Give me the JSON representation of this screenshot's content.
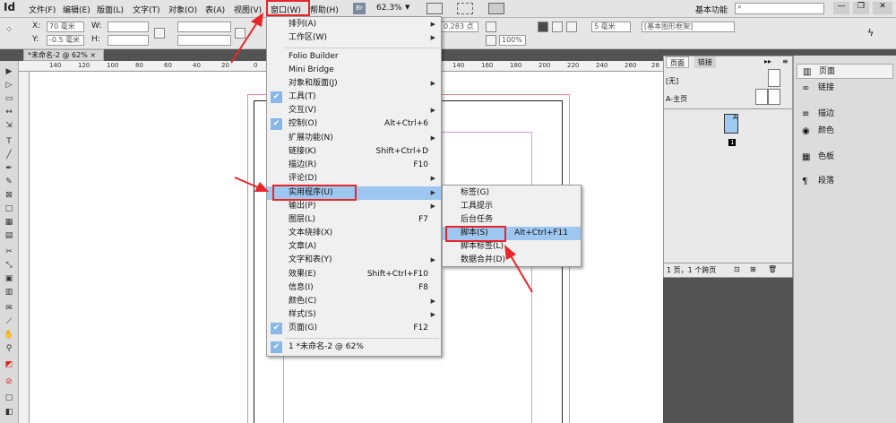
{
  "menubar": {
    "logo": "Id",
    "items": [
      "文件(F)",
      "编辑(E)",
      "版面(L)",
      "文字(T)",
      "对象(O)",
      "表(A)",
      "视图(V)",
      "窗口(W)",
      "帮助(H)"
    ],
    "br_label": "Br",
    "zoom": "62.3%",
    "workspace": "基本功能",
    "search_icon": "search-icon"
  },
  "control": {
    "x_label": "X:",
    "x_value": "70 毫米",
    "y_label": "Y:",
    "y_value": "-0.5 毫米",
    "w_label": "W:",
    "h_label": "H:",
    "stroke_value": "0.283 点",
    "scale_value": "100%",
    "mm_value": "5 毫米",
    "style_value": "[基本图形框架]"
  },
  "doc_tab": "*未命名-2 @ 62% ×",
  "ruler": [
    "140",
    "120",
    "100",
    "80",
    "60",
    "40",
    "20",
    "0",
    "20",
    "40",
    "60",
    "80",
    "100",
    "120",
    "140",
    "160",
    "180",
    "200",
    "220",
    "240",
    "260",
    "28"
  ],
  "window_menu": [
    {
      "label": "排列(A)",
      "submenu": true
    },
    {
      "label": "工作区(W)",
      "submenu": true
    },
    {
      "label": "Folio Builder"
    },
    {
      "label": "Mini Bridge"
    },
    {
      "label": "对象和版面(J)",
      "submenu": true
    },
    {
      "label": "工具(T)",
      "checked": true
    },
    {
      "label": "交互(V)",
      "submenu": true
    },
    {
      "label": "控制(O)",
      "checked": true,
      "shortcut": "Alt+Ctrl+6"
    },
    {
      "label": "扩展功能(N)",
      "submenu": true
    },
    {
      "label": "链接(K)",
      "shortcut": "Shift+Ctrl+D"
    },
    {
      "label": "描边(R)",
      "shortcut": "F10"
    },
    {
      "label": "评论(D)",
      "submenu": true
    },
    {
      "label": "实用程序(U)",
      "submenu": true,
      "highlighted": true
    },
    {
      "label": "输出(P)",
      "submenu": true
    },
    {
      "label": "图层(L)",
      "shortcut": "F7"
    },
    {
      "label": "文本绕排(X)"
    },
    {
      "label": "文章(A)"
    },
    {
      "label": "文字和表(Y)",
      "submenu": true
    },
    {
      "label": "效果(E)",
      "shortcut": "Shift+Ctrl+F10"
    },
    {
      "label": "信息(I)",
      "shortcut": "F8"
    },
    {
      "label": "颜色(C)",
      "submenu": true
    },
    {
      "label": "样式(S)",
      "submenu": true
    },
    {
      "label": "页面(G)",
      "checked": true,
      "shortcut": "F12"
    },
    {
      "label": "1 *未命名-2 @ 62%",
      "checked": true
    }
  ],
  "utility_submenu": [
    {
      "label": "标签(G)"
    },
    {
      "label": "工具提示"
    },
    {
      "label": "后台任务"
    },
    {
      "label": "脚本(S)",
      "shortcut": "Alt+Ctrl+F11",
      "highlighted": true
    },
    {
      "label": "脚本标签(L)"
    },
    {
      "label": "数据合并(D)"
    }
  ],
  "pages_panel": {
    "tabs": [
      "页面",
      "链接"
    ],
    "none_label": "[无]",
    "master_label": "A-主页",
    "page_marker": "A",
    "page_number": "1",
    "status": "1 页，1 个跨页"
  },
  "right_panel": [
    {
      "label": "页面",
      "icon": "pages-icon"
    },
    {
      "label": "链接",
      "icon": "links-icon"
    },
    {
      "label": "描边",
      "icon": "stroke-icon"
    },
    {
      "label": "颜色",
      "icon": "color-icon"
    },
    {
      "label": "色板",
      "icon": "swatches-icon"
    },
    {
      "label": "段落",
      "icon": "paragraph-icon"
    }
  ],
  "colors": {
    "annotation_red": "#e8262a",
    "highlight": "#9dc6f0",
    "check_bg": "#88b8e8"
  }
}
